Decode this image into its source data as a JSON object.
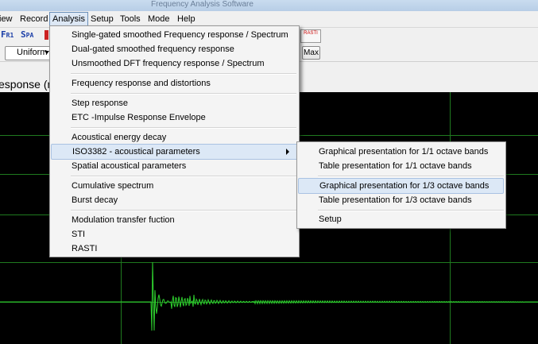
{
  "window": {
    "title": "Frequency Analysis Software"
  },
  "menubar": [
    {
      "label": "iew",
      "key": "view"
    },
    {
      "label": "Record",
      "key": "record"
    },
    {
      "label": "Analysis",
      "key": "analysis",
      "active": true
    },
    {
      "label": "Setup",
      "key": "setup"
    },
    {
      "label": "Tools",
      "key": "tools"
    },
    {
      "label": "Mode",
      "key": "mode"
    },
    {
      "label": "Help",
      "key": "help"
    }
  ],
  "toolbar": {
    "fr1": {
      "big": "F",
      "small": "R1"
    },
    "spa": {
      "big": "S",
      "small": "PA"
    },
    "rasti_label": "RASTI",
    "window_select": "Uniform",
    "max_label": "Max"
  },
  "graph": {
    "title": "esponse (m"
  },
  "analysis_menu": {
    "groups": [
      [
        "Single-gated smoothed Frequency response / Spectrum",
        "Dual-gated smoothed frequency response",
        "Unsmoothed DFT frequency response / Spectrum"
      ],
      [
        "Frequency response and distortions"
      ],
      [
        "Step response",
        "ETC -Impulse Response Envelope"
      ],
      [
        "Acoustical energy decay",
        "ISO3382 - acoustical parameters",
        "Spatial acoustical parameters"
      ],
      [
        "Cumulative spectrum",
        "Burst decay"
      ],
      [
        "Modulation transfer fuction",
        "STI",
        "RASTI"
      ]
    ],
    "highlighted": "ISO3382 - acoustical parameters"
  },
  "iso_submenu": {
    "groups": [
      [
        "Graphical presentation for 1/1 octave bands",
        "Table presentation for 1/1 octave bands"
      ],
      [
        "Graphical presentation for 1/3 octave bands",
        "Table presentation for 1/3 octave bands"
      ],
      [
        "Setup"
      ]
    ],
    "highlighted": "Graphical presentation for 1/3 octave bands"
  },
  "colors": {
    "trace": "#2ed12e",
    "grid": "#1f7a1f",
    "background": "#000000",
    "menu_highlight": "#dce8f6"
  }
}
